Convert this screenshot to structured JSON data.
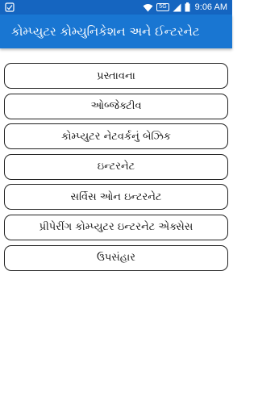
{
  "status_bar": {
    "network": "5G",
    "time": "9:06 AM",
    "icons": [
      "notification-icon",
      "wifi-icon",
      "signal-icon",
      "battery-icon"
    ]
  },
  "app_bar": {
    "title": "કોમ્પ્યુટર કોમ્યુનિકેશન અને ઈન્ટરનેટ",
    "background": "#1976d2"
  },
  "menu": {
    "items": [
      {
        "label": "પ્રસ્તાવના"
      },
      {
        "label": "ઓબ્જેક્ટીવ"
      },
      {
        "label": "કોમ્પ્યુટર નેટવર્કનું બેઝિક"
      },
      {
        "label": "ઇન્ટરનેટ"
      },
      {
        "label": "સર્વિસ ઓન ઇન્ટરનેટ"
      },
      {
        "label": "પ્રીપેરીંગ કોમ્પ્યુટર ઇન્ટરનેટ એક્સેસ"
      },
      {
        "label": "ઉપસંહાર"
      }
    ]
  }
}
